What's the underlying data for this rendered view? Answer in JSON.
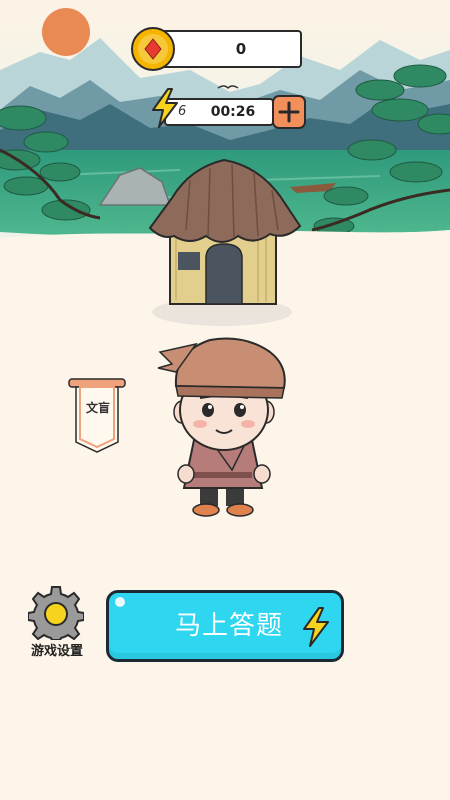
{
  "hud": {
    "coins": "0",
    "energy_count": "6",
    "energy_timer": "00:26"
  },
  "rank": {
    "title": "文盲"
  },
  "actions": {
    "settings_label": "游戏设置",
    "answer_label": "马上答题"
  },
  "icons": {
    "coin": "coin-icon",
    "energy": "lightning-icon",
    "add": "plus-icon",
    "settings": "gear-icon",
    "answer": "lightning-icon"
  },
  "colors": {
    "background": "#fdf5ea",
    "answer_button": "#2ed6f0",
    "plus_button": "#f28f5b",
    "coin": "#f5b400",
    "lightning": "#f6d31c"
  }
}
